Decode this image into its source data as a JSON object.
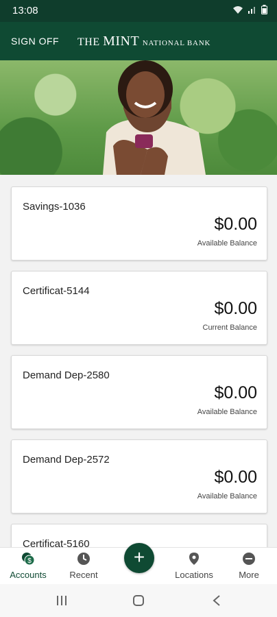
{
  "status": {
    "time": "13:08"
  },
  "appbar": {
    "signoff": "SIGN OFF",
    "brand_prefix": "THE",
    "brand_main": "MINT",
    "brand_suffix": "NATIONAL BANK"
  },
  "accounts": [
    {
      "name": "Savings-1036",
      "amount": "$0.00",
      "label": "Available Balance"
    },
    {
      "name": "Certificat-5144",
      "amount": "$0.00",
      "label": "Current Balance"
    },
    {
      "name": "Demand Dep-2580",
      "amount": "$0.00",
      "label": "Available Balance"
    },
    {
      "name": "Demand Dep-2572",
      "amount": "$0.00",
      "label": "Available Balance"
    },
    {
      "name": "Certificat-5160",
      "amount": "",
      "label": ""
    }
  ],
  "tabs": [
    {
      "label": "Accounts",
      "icon": "accounts-icon"
    },
    {
      "label": "Recent",
      "icon": "clock-icon"
    },
    {
      "label": "Locations",
      "icon": "location-pin-icon"
    },
    {
      "label": "More",
      "icon": "more-icon"
    }
  ],
  "fab_label": "+",
  "colors": {
    "brand": "#0f4a33",
    "statusbar": "#0f3d2c",
    "background": "#f2f2f2"
  }
}
